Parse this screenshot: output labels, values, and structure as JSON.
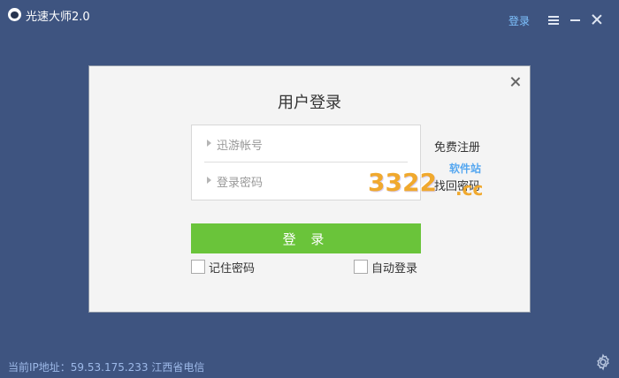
{
  "titlebar": {
    "app_title": "光速大师2.0",
    "login_link": "登录",
    "logo_icon": "app-logo-icon",
    "menu_icon": "menu-icon",
    "minimize_icon": "minimize-icon",
    "close_icon": "close-icon"
  },
  "dialog": {
    "title": "用户登录",
    "account_placeholder": "迅游帐号",
    "password_placeholder": "登录密码",
    "register_link": "免费注册",
    "recover_link": "找回密码",
    "login_button": "登 录",
    "remember_label": "记住密码",
    "remember_checked": false,
    "auto_login_label": "自动登录",
    "auto_login_checked": false,
    "close_icon": "close-icon"
  },
  "watermark": {
    "number": "3322",
    "top_text": "软件站",
    "domain": ".cc"
  },
  "footer": {
    "ip_text": "当前IP地址：59.53.175.233 江西省电信",
    "settings_icon": "gear-icon"
  },
  "colors": {
    "background": "#3e5480",
    "accent_green": "#6ac43a",
    "link_blue": "#7fc3ff"
  }
}
